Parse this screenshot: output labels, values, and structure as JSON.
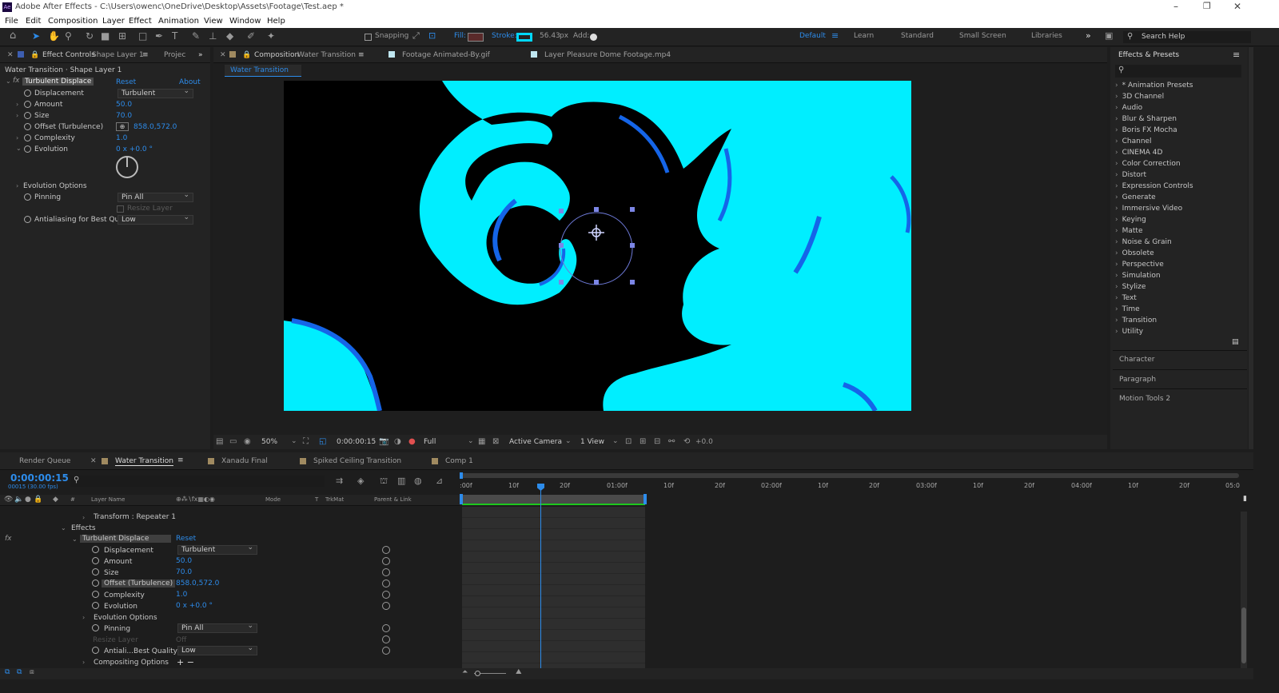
{
  "window": {
    "title": "Adobe After Effects - C:\\Users\\owenc\\OneDrive\\Desktop\\Assets\\Footage\\Test.aep *"
  },
  "menu": [
    "File",
    "Edit",
    "Composition",
    "Layer",
    "Effect",
    "Animation",
    "View",
    "Window",
    "Help"
  ],
  "toolbar": {
    "snapping": "Snapping",
    "fill": "Fill:",
    "stroke": "Stroke:",
    "stroke_width": "56.43",
    "stroke_unit": "px",
    "add": "Add:",
    "workspaces": [
      "Default",
      "Learn",
      "Standard",
      "Small Screen",
      "Libraries"
    ],
    "search_help": "Search Help"
  },
  "effect_controls": {
    "tab_prefix": "Effect Controls",
    "tab_layer": "Shape Layer 1",
    "project_tab": "Projec",
    "breadcrumb": "Water Transition · Shape Layer 1",
    "effect_name": "Turbulent Displace",
    "reset": "Reset",
    "about": "About",
    "props": [
      {
        "name": "Displacement",
        "value": "Turbulent"
      },
      {
        "name": "Amount",
        "value": "50.0"
      },
      {
        "name": "Size",
        "value": "70.0"
      },
      {
        "name": "Offset (Turbulence)",
        "value": "858.0,572.0"
      },
      {
        "name": "Complexity",
        "value": "1.0"
      },
      {
        "name": "Evolution",
        "value": "0 x +0.0 °"
      },
      {
        "name": "Evolution Options",
        "value": ""
      },
      {
        "name": "Pinning",
        "value": "Pin All"
      },
      {
        "name": "Resize Layer",
        "value": ""
      },
      {
        "name": "Antialiasing for Best Qu",
        "value": "Low"
      }
    ]
  },
  "composition": {
    "tabs": [
      {
        "prefix": "Composition",
        "name": "Water Transition"
      },
      {
        "prefix": "",
        "name": "Footage Animated-By.gif"
      },
      {
        "prefix": "",
        "name": "Layer Pleasure Dome Footage.mp4"
      }
    ],
    "flow": "Water Transition",
    "footer": {
      "zoom": "50%",
      "time": "0:00:00:15",
      "resolution": "Full",
      "camera": "Active Camera",
      "views": "1 View",
      "exposure": "+0.0"
    }
  },
  "effects_presets": {
    "title": "Effects & Presets",
    "categories": [
      "* Animation Presets",
      "3D Channel",
      "Audio",
      "Blur & Sharpen",
      "Boris FX Mocha",
      "Channel",
      "CINEMA 4D",
      "Color Correction",
      "Distort",
      "Expression Controls",
      "Generate",
      "Immersive Video",
      "Keying",
      "Matte",
      "Noise & Grain",
      "Obsolete",
      "Perspective",
      "Simulation",
      "Stylize",
      "Text",
      "Time",
      "Transition",
      "Utility"
    ],
    "collapsed": [
      "Character",
      "Paragraph",
      "Motion Tools 2"
    ]
  },
  "timeline": {
    "tabs": [
      "Render Queue",
      "Water Transition",
      "Xanadu Final",
      "Spiked Ceiling Transition",
      "Comp 1"
    ],
    "timecode": "0:00:00:15",
    "frames": "00015 (30.00 fps)",
    "columns": {
      "layer_name": "Layer Name",
      "mode": "Mode",
      "t": "T",
      "trkmat": "TrkMat",
      "parent": "Parent & Link"
    },
    "ruler": [
      ":00f",
      "10f",
      "20f",
      "01:00f",
      "10f",
      "20f",
      "02:00f",
      "10f",
      "20f",
      "03:00f",
      "10f",
      "20f",
      "04:00f",
      "10f",
      "20f",
      "05:0"
    ],
    "rows": [
      {
        "label": "Transform : Repeater 1",
        "value": ""
      },
      {
        "label": "Effects",
        "value": ""
      },
      {
        "label": "Turbulent Displace",
        "value": "Reset"
      },
      {
        "label": "Displacement",
        "value": "Turbulent"
      },
      {
        "label": "Amount",
        "value": "50.0"
      },
      {
        "label": "Size",
        "value": "70.0"
      },
      {
        "label": "Offset (Turbulence)",
        "value": "858.0,572.0"
      },
      {
        "label": "Complexity",
        "value": "1.0"
      },
      {
        "label": "Evolution",
        "value": "0 x +0.0 °"
      },
      {
        "label": "Evolution Options",
        "value": ""
      },
      {
        "label": "Pinning",
        "value": "Pin All"
      },
      {
        "label": "Resize Layer",
        "value": "Off"
      },
      {
        "label": "Antiali...Best Quality",
        "value": "Low"
      },
      {
        "label": "Compositing Options",
        "value": "+ −"
      }
    ]
  },
  "colors": {
    "accent": "#2d8ceb",
    "cyan": "#00e5ff",
    "deep_blue": "#1565e8"
  }
}
